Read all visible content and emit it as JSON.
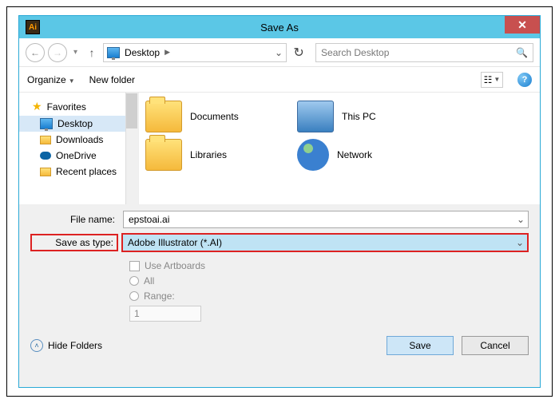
{
  "title": "Save As",
  "nav": {
    "location": "Desktop",
    "search_placeholder": "Search Desktop"
  },
  "toolbar": {
    "organize": "Organize",
    "newfolder": "New folder"
  },
  "sidebar": {
    "favorites": "Favorites",
    "items": [
      {
        "label": "Desktop"
      },
      {
        "label": "Downloads"
      },
      {
        "label": "OneDrive"
      },
      {
        "label": "Recent places"
      }
    ]
  },
  "content": {
    "items": [
      {
        "label": "Documents"
      },
      {
        "label": "This PC"
      },
      {
        "label": "Libraries"
      },
      {
        "label": "Network"
      }
    ]
  },
  "form": {
    "filename_label": "File name:",
    "filename_value": "epstoai.ai",
    "savetype_label": "Save as type:",
    "savetype_value": "Adobe Illustrator (*.AI)",
    "use_artboards": "Use Artboards",
    "all": "All",
    "range": "Range:",
    "range_value": "1"
  },
  "footer": {
    "hide": "Hide Folders",
    "save": "Save",
    "cancel": "Cancel"
  }
}
